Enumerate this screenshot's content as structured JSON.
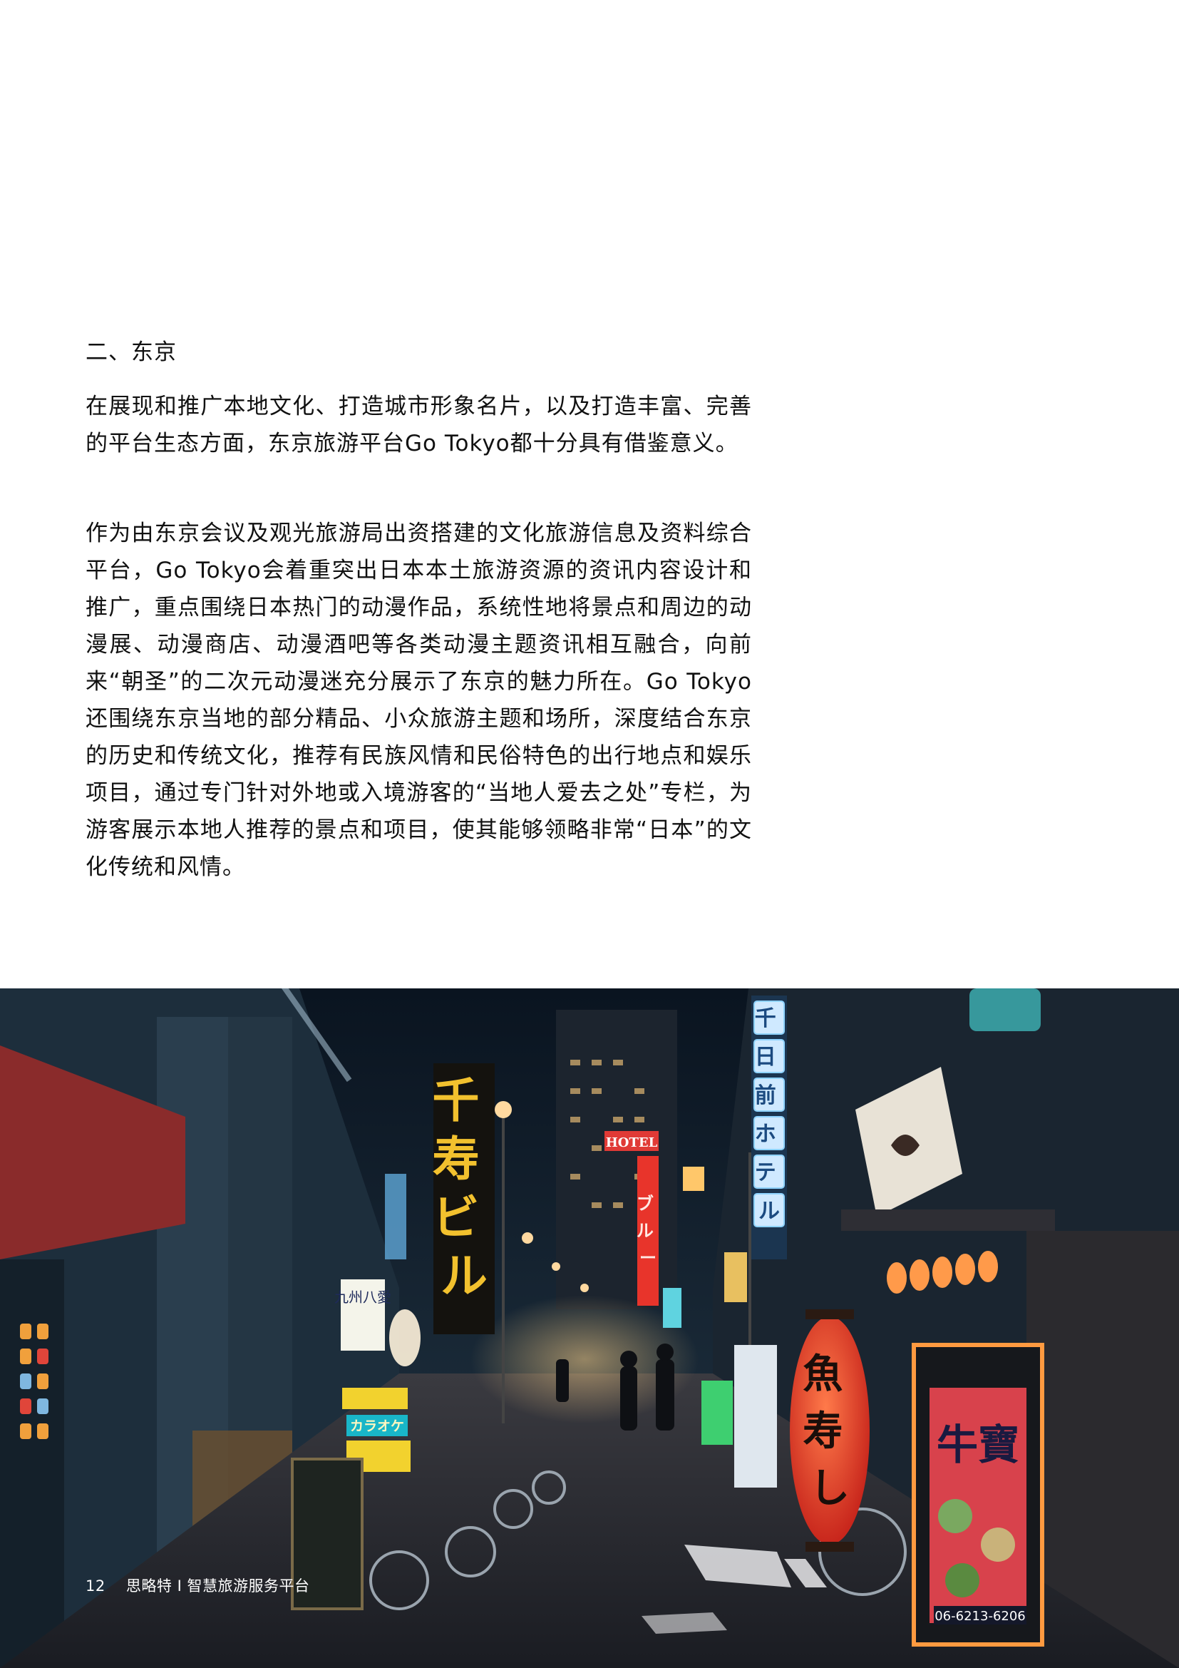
{
  "section": {
    "heading": "二、东京",
    "paragraphs": [
      "在展现和推广本地文化、打造城市形象名片，以及打造丰富、完善的平台生态方面，东京旅游平台Go Tokyo都十分具有借鉴意义。",
      "作为由东京会议及观光旅游局出资搭建的文化旅游信息及资料综合平台，Go Tokyo会着重突出日本本土旅游资源的资讯内容设计和推广，重点围绕日本热门的动漫作品，系统性地将景点和周边的动漫展、动漫商店、动漫酒吧等各类动漫主题资讯相互融合，向前来“朝圣”的二次元动漫迷充分展示了东京的魅力所在。Go Tokyo还围绕东京当地的部分精品、小众旅游主题和场所，深度结合东京的历史和传统文化，推荐有民族风情和民俗特色的出行地点和娱乐项目，通过专门针对外地或入境游客的“当地人爱去之处”专栏，为游客展示本地人推荐的景点和项目，使其能够领略非常“日本”的文化传统和风情。"
    ]
  },
  "photo": {
    "signs": {
      "big_yellow": "千寿ビル",
      "hotel": "HOTEL",
      "red_vertical": "ブルー",
      "blue_vertical": "千日前ホテル",
      "lantern": "魚寿し",
      "board_right": "牛寶",
      "phone": "06-6213-6206",
      "small_sign": "九州八愛",
      "karaoke": "カラオケ"
    },
    "colors": {
      "sky": "#0d1a26",
      "street": "#1b2530",
      "neon_yellow": "#f2c12e",
      "neon_red": "#e8342b",
      "neon_blue": "#8fd3ff"
    }
  },
  "footer": {
    "page_number": "12",
    "text": "思略特 I 智慧旅游服务平台"
  }
}
